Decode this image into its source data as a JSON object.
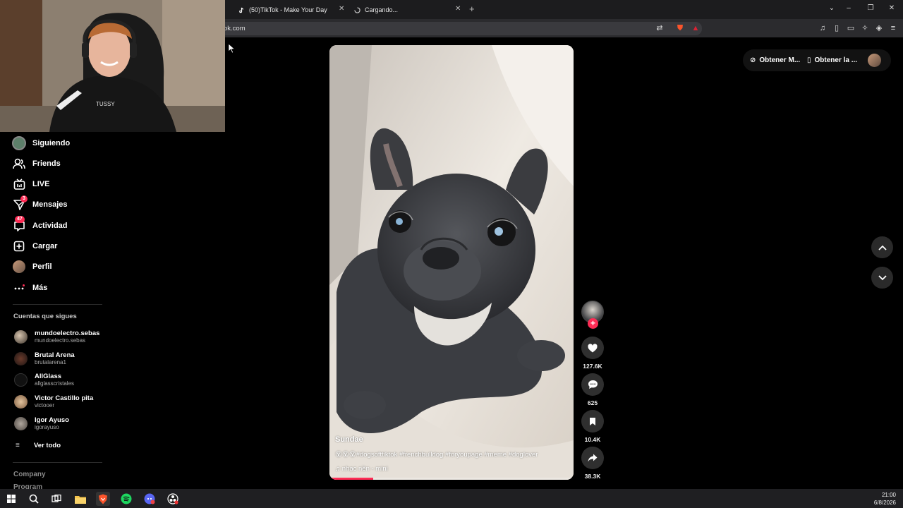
{
  "browser": {
    "tabs": [
      {
        "label": "(50)TikTok - Make Your Day"
      },
      {
        "label": "Cargando..."
      }
    ],
    "url": "ok.com"
  },
  "sidebar": {
    "items": [
      {
        "label": "Siguiendo",
        "icon": "following-avatar-icon"
      },
      {
        "label": "Friends",
        "icon": "friends-icon"
      },
      {
        "label": "LIVE",
        "icon": "live-icon"
      },
      {
        "label": "Mensajes",
        "icon": "messages-icon",
        "badge": "3"
      },
      {
        "label": "Actividad",
        "icon": "activity-icon",
        "badge": "47"
      },
      {
        "label": "Cargar",
        "icon": "upload-icon"
      },
      {
        "label": "Perfil",
        "icon": "profile-avatar-icon"
      },
      {
        "label": "Más",
        "icon": "more-icon"
      }
    ],
    "following_title": "Cuentas que sigues",
    "following": [
      {
        "name": "mundoelectro.sebas",
        "handle": "mundoelectro.sebas"
      },
      {
        "name": "Brutal Arena",
        "handle": "brutalarena1"
      },
      {
        "name": "AllGlass",
        "handle": "allglasscristales"
      },
      {
        "name": "Victor Castillo pita",
        "handle": "victooer"
      },
      {
        "name": "Igor Ayuso",
        "handle": "igorayuso"
      }
    ],
    "see_all": "Ver todo",
    "footer": {
      "company": "Company",
      "program": "Program"
    }
  },
  "video": {
    "author": "Sundae",
    "caption": "😵😵😵#dogsofttiktok #frenchbulldog #foryoupage #meme #doglover",
    "music": "nhạc nền - mini",
    "progress": 0.18
  },
  "actions": {
    "likes": "127.6K",
    "comments": "625",
    "saves": "10.4K",
    "shares": "38.3K"
  },
  "topright": {
    "coins": "Obtener M...",
    "app": "Obtener la ..."
  },
  "taskbar": {
    "time": "21:00",
    "date": "6/8/2026"
  },
  "colors": {
    "accent": "#fe2c55",
    "background": "#000000"
  }
}
